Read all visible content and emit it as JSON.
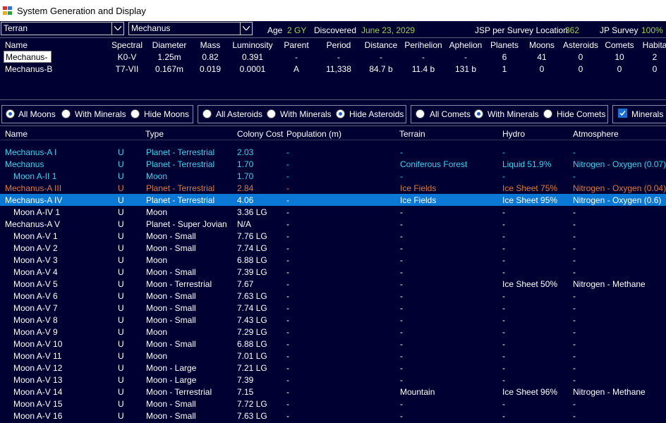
{
  "window": {
    "title": "System Generation and Display"
  },
  "controls": {
    "race_select": "Terran",
    "system_select": "Mechanus",
    "age_label": "Age",
    "age_value": "2 GY",
    "discovered_label": "Discovered",
    "discovered_value": "June 23, 2029",
    "jsp_label": "JSP per Survey Location",
    "jsp_value": "362",
    "jp_label": "JP Survey",
    "jp_value": "100%"
  },
  "stars": {
    "headers": [
      "Name",
      "Spectral",
      "Diameter",
      "Mass",
      "Luminosity",
      "Parent",
      "Period",
      "Distance",
      "Perihelion",
      "Aphelion",
      "Planets",
      "Moons",
      "Asteroids",
      "Comets",
      "Habita"
    ],
    "rows": [
      [
        "Mechanus-A",
        "K0-V",
        "1.25m",
        "0.82",
        "0.391",
        "-",
        "-",
        "-",
        "-",
        "-",
        "6",
        "41",
        "0",
        "10",
        "2"
      ],
      [
        "Mechanus-B",
        "T7-VII",
        "0.167m",
        "0.019",
        "0.0001",
        "A",
        "11,338",
        "84.7 b",
        "11.4 b",
        "131 b",
        "1",
        "0",
        "0",
        "0",
        "0"
      ]
    ]
  },
  "filters": {
    "moons": {
      "opts": [
        "All Moons",
        "With Minerals",
        "Hide Moons"
      ],
      "selected": 0
    },
    "asteroids": {
      "opts": [
        "All Asteroids",
        "With Minerals",
        "Hide Asteroids"
      ],
      "selected": 2
    },
    "comets": {
      "opts": [
        "All Comets",
        "With Minerals",
        "Hide Comets"
      ],
      "selected": 1
    },
    "minerals_label": "Minerals",
    "minerals_checked": true
  },
  "bodies": {
    "headers": [
      "Name",
      "Type",
      "Colony Cost",
      "Population (m)",
      "Terrain",
      "Hydro",
      "Atmosphere"
    ],
    "rows": [
      {
        "name": "Mechanus-A I",
        "u": "U",
        "type": "Planet - Terrestrial",
        "cost": "2.03",
        "pop": "-",
        "terrain": "-",
        "hydro": "-",
        "atmo": "-",
        "color": "cyan",
        "indent": false
      },
      {
        "name": "Mechanus",
        "u": "U",
        "type": "Planet - Terrestrial",
        "cost": "1.70",
        "pop": "-",
        "terrain": "Coniferous Forest",
        "hydro": "Liquid 51.9%",
        "atmo": "Nitrogen - Oxygen (0.07)",
        "color": "cyan",
        "indent": false
      },
      {
        "name": "Moon A-II 1",
        "u": "U",
        "type": "Moon",
        "cost": "1.70",
        "pop": "-",
        "terrain": "-",
        "hydro": "-",
        "atmo": "-",
        "color": "cyan",
        "indent": true
      },
      {
        "name": "Mechanus-A III",
        "u": "U",
        "type": "Planet - Terrestrial",
        "cost": "2.84",
        "pop": "-",
        "terrain": "Ice Fields",
        "hydro": "Ice Sheet 75%",
        "atmo": "Nitrogen - Oxygen (0.04)",
        "color": "orange",
        "indent": false
      },
      {
        "name": "Mechanus-A IV",
        "u": "U",
        "type": "Planet - Terrestrial",
        "cost": "4.06",
        "pop": "-",
        "terrain": "Ice Fields",
        "hydro": "Ice Sheet 95%",
        "atmo": "Nitrogen - Oxygen (0.6)",
        "color": "white",
        "indent": false,
        "selected": true
      },
      {
        "name": "Moon A-IV 1",
        "u": "U",
        "type": "Moon",
        "cost": "3.36 LG",
        "pop": "-",
        "terrain": "-",
        "hydro": "-",
        "atmo": "-",
        "color": "white",
        "indent": true
      },
      {
        "name": "Mechanus-A V",
        "u": "U",
        "type": "Planet - Super Jovian",
        "cost": "N/A",
        "pop": "-",
        "terrain": "-",
        "hydro": "-",
        "atmo": "-",
        "color": "white",
        "indent": false
      },
      {
        "name": "Moon A-V 1",
        "u": "U",
        "type": "Moon - Small",
        "cost": "7.76 LG",
        "pop": "-",
        "terrain": "-",
        "hydro": "-",
        "atmo": "-",
        "color": "white",
        "indent": true
      },
      {
        "name": "Moon A-V 2",
        "u": "U",
        "type": "Moon - Small",
        "cost": "7.74 LG",
        "pop": "-",
        "terrain": "-",
        "hydro": "-",
        "atmo": "-",
        "color": "white",
        "indent": true
      },
      {
        "name": "Moon A-V 3",
        "u": "U",
        "type": "Moon",
        "cost": "6.88 LG",
        "pop": "-",
        "terrain": "-",
        "hydro": "-",
        "atmo": "-",
        "color": "white",
        "indent": true
      },
      {
        "name": "Moon A-V 4",
        "u": "U",
        "type": "Moon - Small",
        "cost": "7.39 LG",
        "pop": "-",
        "terrain": "-",
        "hydro": "-",
        "atmo": "-",
        "color": "white",
        "indent": true
      },
      {
        "name": "Moon A-V 5",
        "u": "U",
        "type": "Moon - Terrestrial",
        "cost": "7.67",
        "pop": "-",
        "terrain": "-",
        "hydro": "Ice Sheet 50%",
        "atmo": "Nitrogen - Methane",
        "color": "white",
        "indent": true
      },
      {
        "name": "Moon A-V 6",
        "u": "U",
        "type": "Moon - Small",
        "cost": "7.63 LG",
        "pop": "-",
        "terrain": "-",
        "hydro": "-",
        "atmo": "-",
        "color": "white",
        "indent": true
      },
      {
        "name": "Moon A-V 7",
        "u": "U",
        "type": "Moon - Small",
        "cost": "7.74 LG",
        "pop": "-",
        "terrain": "-",
        "hydro": "-",
        "atmo": "-",
        "color": "white",
        "indent": true
      },
      {
        "name": "Moon A-V 8",
        "u": "U",
        "type": "Moon - Small",
        "cost": "7.43 LG",
        "pop": "-",
        "terrain": "-",
        "hydro": "-",
        "atmo": "-",
        "color": "white",
        "indent": true
      },
      {
        "name": "Moon A-V 9",
        "u": "U",
        "type": "Moon",
        "cost": "7.29 LG",
        "pop": "-",
        "terrain": "-",
        "hydro": "-",
        "atmo": "-",
        "color": "white",
        "indent": true
      },
      {
        "name": "Moon A-V 10",
        "u": "U",
        "type": "Moon - Small",
        "cost": "6.88 LG",
        "pop": "-",
        "terrain": "-",
        "hydro": "-",
        "atmo": "-",
        "color": "white",
        "indent": true
      },
      {
        "name": "Moon A-V 11",
        "u": "U",
        "type": "Moon",
        "cost": "7.01 LG",
        "pop": "-",
        "terrain": "-",
        "hydro": "-",
        "atmo": "-",
        "color": "white",
        "indent": true
      },
      {
        "name": "Moon A-V 12",
        "u": "U",
        "type": "Moon - Large",
        "cost": "7.21 LG",
        "pop": "-",
        "terrain": "-",
        "hydro": "-",
        "atmo": "-",
        "color": "white",
        "indent": true
      },
      {
        "name": "Moon A-V 13",
        "u": "U",
        "type": "Moon - Large",
        "cost": "7.39",
        "pop": "-",
        "terrain": "-",
        "hydro": "-",
        "atmo": "-",
        "color": "white",
        "indent": true
      },
      {
        "name": "Moon A-V 14",
        "u": "U",
        "type": "Moon - Terrestrial",
        "cost": "7.15",
        "pop": "-",
        "terrain": "Mountain",
        "hydro": "Ice Sheet 96%",
        "atmo": "Nitrogen - Methane",
        "color": "white",
        "indent": true
      },
      {
        "name": "Moon A-V 15",
        "u": "U",
        "type": "Moon - Small",
        "cost": "7.72 LG",
        "pop": "-",
        "terrain": "-",
        "hydro": "-",
        "atmo": "-",
        "color": "white",
        "indent": true
      },
      {
        "name": "Moon A-V 16",
        "u": "U",
        "type": "Moon - Small",
        "cost": "7.63 LG",
        "pop": "-",
        "terrain": "-",
        "hydro": "-",
        "atmo": "-",
        "color": "white",
        "indent": true
      }
    ]
  }
}
